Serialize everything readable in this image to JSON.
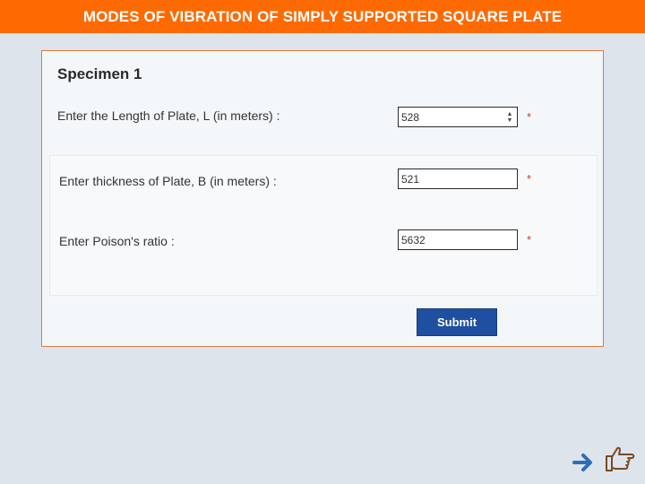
{
  "header": {
    "title": "MODES OF VIBRATION OF SIMPLY SUPPORTED SQUARE PLATE"
  },
  "form": {
    "title": "Specimen 1",
    "fields": [
      {
        "label": "Enter the Length of Plate, L (in meters) :",
        "value": "528",
        "required_mark": "*"
      },
      {
        "label": "Enter thickness of Plate, B (in meters) :",
        "value": "521",
        "required_mark": "*"
      },
      {
        "label": "Enter Poison's ratio :",
        "value": "5632",
        "required_mark": "*"
      }
    ],
    "submit_label": "Submit"
  },
  "nav": {
    "next_icon": "arrow-right-icon",
    "pointer_icon": "hand-pointer-icon"
  },
  "colors": {
    "header_bg": "#ff6a00",
    "panel_border": "#e07a3a",
    "submit_bg": "#1f4fa0",
    "required": "#e03030",
    "page_bg": "#dde4ec"
  }
}
